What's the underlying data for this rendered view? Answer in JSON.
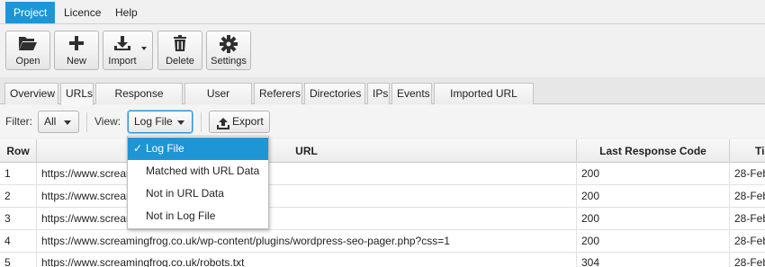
{
  "menubar": {
    "items": [
      "Project",
      "Licence",
      "Help"
    ]
  },
  "toolbar": {
    "open_label": "Open",
    "new_label": "New",
    "import_label": "Import",
    "delete_label": "Delete",
    "settings_label": "Settings"
  },
  "tabs": [
    "Overview",
    "URLs",
    "Response Codes",
    "User Agents",
    "Referers",
    "Directories",
    "IPs",
    "Events",
    "Imported URL Data"
  ],
  "filterbar": {
    "filter_label": "Filter:",
    "filter_value": "All",
    "view_label": "View:",
    "view_value": "Log File",
    "export_label": "Export"
  },
  "view_options": [
    {
      "label": "Log File",
      "check": "✓"
    },
    {
      "label": "Matched with URL Data"
    },
    {
      "label": "Not in URL Data"
    },
    {
      "label": "Not in Log File"
    }
  ],
  "table": {
    "columns": [
      "Row",
      "URL",
      "Last Response Code",
      "Ti"
    ],
    "rows": [
      {
        "row": "1",
        "url": "https://www.screamingfrog.co.uk/",
        "code": "200",
        "time": "28-Feb"
      },
      {
        "row": "2",
        "url": "https://www.screamingfrog.co.uk/",
        "code": "200",
        "time": "28-Feb"
      },
      {
        "row": "3",
        "url": "https://www.screamingfrog.co.uk/",
        "code": "200",
        "time": "28-Feb"
      },
      {
        "row": "4",
        "url": "https://www.screamingfrog.co.uk/wp-content/plugins/wordpress-seo-pager.php?css=1",
        "code": "200",
        "time": "28-Feb"
      },
      {
        "row": "5",
        "url": "https://www.screamingfrog.co.uk/robots.txt",
        "code": "304",
        "time": "28-Feb"
      }
    ]
  },
  "colors": {
    "accent": "#1e96d6"
  }
}
